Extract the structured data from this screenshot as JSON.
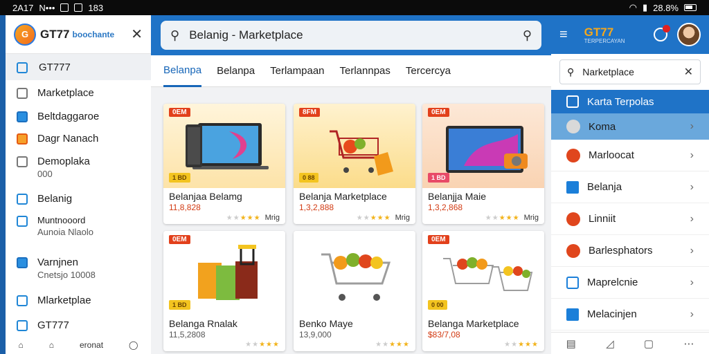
{
  "status_bar": {
    "time": "2A17",
    "left_text": "N•••",
    "right_text": "28.8%",
    "extra": "183"
  },
  "left_panel": {
    "brand": "GT77",
    "brand_sub": "boochante",
    "active_item": "GT777",
    "items": [
      {
        "label": "Marketplace",
        "sub": ""
      },
      {
        "label": "Beltdaggaroe",
        "sub": ""
      },
      {
        "label": "Dagr Nanach",
        "sub": ""
      },
      {
        "label": "Demoplaka",
        "sub": "000"
      },
      {
        "label": "Belanig",
        "sub": ""
      },
      {
        "label": "Muntnooord",
        "sub": "Aunoia Nlaolo"
      },
      {
        "label": "Varnjnen",
        "sub": "Cnetsjo 10008"
      },
      {
        "label": "Mlarketplae",
        "sub": ""
      },
      {
        "label": "GT777",
        "sub": ""
      }
    ],
    "bottom_label": "eronat"
  },
  "center": {
    "search_text": "Belanig - Marketplace",
    "tabs": [
      "Belanpa",
      "Belanpa",
      "Terlampaan",
      "Terlannpas",
      "Tercercya"
    ],
    "cards": [
      {
        "badge": "0EM",
        "badge2": "1 BD",
        "title": "Belanjaa Belamg",
        "price": "11,8,828",
        "rating": 3,
        "mini": "Mrig"
      },
      {
        "badge": "8FM",
        "badge2": "0 88",
        "title": "Belanja Marketplace",
        "price": "1,3,2,888",
        "rating": 3,
        "mini": "Mrig"
      },
      {
        "badge": "0EM",
        "badge2": "1 BD",
        "title": "Belanjja Maie",
        "price": "1,3,2,868",
        "rating": 3,
        "mini": "Mrig"
      },
      {
        "badge": "0EM",
        "badge2": "1 BD",
        "title": "Belanga Rnalak",
        "price": "11,5,2808",
        "rating": 3,
        "mini": ""
      },
      {
        "badge": "",
        "badge2": "",
        "title": "Benko Maye",
        "price": "13,9,000",
        "rating": 3,
        "mini": ""
      },
      {
        "badge": "0EM",
        "badge2": "0 00",
        "title": "Belanga Marketplace",
        "price": "$83/7,08",
        "rating": 3,
        "mini": ""
      }
    ]
  },
  "right_panel": {
    "brand": "GT77",
    "brand_sub": "TERPERCAYAN",
    "search_text": "Narketplace",
    "blue_row": "Karta Terpolas",
    "light_row": "Koma",
    "rows": [
      "Marloocat",
      "Belanja",
      "Linniit",
      "Barlesphators",
      "Maprelcnie",
      "Melacinjen"
    ]
  },
  "colors": {
    "primary": "#1f73c7",
    "accent": "#f7a81b",
    "badge": "#e2401b"
  }
}
